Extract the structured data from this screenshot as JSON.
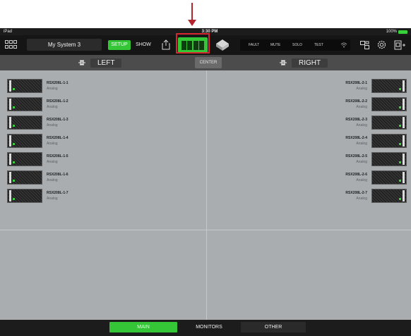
{
  "status_bar": {
    "carrier": "iPad",
    "time": "3:30 PM",
    "battery": "100%"
  },
  "toolbar": {
    "system_name": "My System 3",
    "setup_label": "SETUP",
    "show_label": "SHOW",
    "indicators": [
      "FAULT",
      "MUTE",
      "SOLO",
      "TEST"
    ]
  },
  "sides": {
    "left_label": "LEFT",
    "center_label": "CENTER",
    "right_label": "RIGHT"
  },
  "left_speakers": [
    {
      "name": "RSX208L-1-1",
      "type": "Analog"
    },
    {
      "name": "RSX208L-1-2",
      "type": "Analog"
    },
    {
      "name": "RSX208L-1-3",
      "type": "Analog"
    },
    {
      "name": "RSX208L-1-4",
      "type": "Analog"
    },
    {
      "name": "RSX208L-1-5",
      "type": "Analog"
    },
    {
      "name": "RSX208L-1-6",
      "type": "Analog"
    },
    {
      "name": "RSX208L-1-7",
      "type": "Analog"
    }
  ],
  "right_speakers": [
    {
      "name": "RSX208L-2-1",
      "type": "Analog"
    },
    {
      "name": "RSX208L-2-2",
      "type": "Analog"
    },
    {
      "name": "RSX208L-2-3",
      "type": "Analog"
    },
    {
      "name": "RSX208L-2-4",
      "type": "Analog"
    },
    {
      "name": "RSX208L-2-5",
      "type": "Analog"
    },
    {
      "name": "RSX208L-2-6",
      "type": "Analog"
    },
    {
      "name": "RSX208L-2-7",
      "type": "Analog"
    }
  ],
  "bottom_tabs": [
    "MAIN",
    "MONITORS",
    "OTHER"
  ],
  "colors": {
    "accent": "#34c636",
    "annotation": "#d3282f",
    "background": "#a9adb0"
  }
}
